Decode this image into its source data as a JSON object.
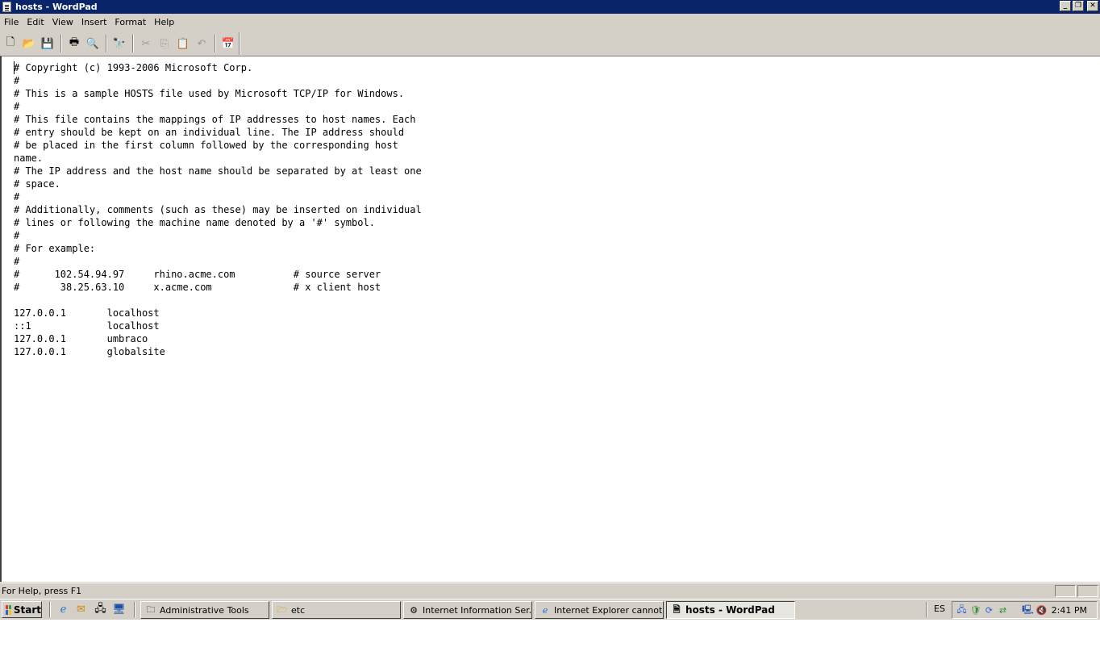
{
  "window": {
    "title": "hosts - WordPad",
    "controls": {
      "minimize": "_",
      "restore": "❐",
      "close": "✕"
    }
  },
  "menu": [
    "File",
    "Edit",
    "View",
    "Insert",
    "Format",
    "Help"
  ],
  "toolbar": {
    "icons": [
      {
        "name": "new-document-icon",
        "glyph": "🗋",
        "enabled": true
      },
      {
        "name": "open-folder-icon",
        "glyph": "📂",
        "enabled": true
      },
      {
        "name": "save-icon",
        "glyph": "💾",
        "enabled": true
      },
      {
        "name": "print-icon",
        "glyph": "🖶",
        "enabled": true
      },
      {
        "name": "print-preview-icon",
        "glyph": "🔍",
        "enabled": true
      },
      {
        "name": "find-binoculars-icon",
        "glyph": "🔭",
        "enabled": true
      },
      {
        "name": "cut-icon",
        "glyph": "✂",
        "enabled": false
      },
      {
        "name": "copy-icon",
        "glyph": "⎘",
        "enabled": false
      },
      {
        "name": "paste-icon",
        "glyph": "📋",
        "enabled": true
      },
      {
        "name": "undo-icon",
        "glyph": "↶",
        "enabled": false
      },
      {
        "name": "insert-date-time-icon",
        "glyph": "📅",
        "enabled": true
      }
    ]
  },
  "document": {
    "lines": [
      "# Copyright (c) 1993-2006 Microsoft Corp.",
      "#",
      "# This is a sample HOSTS file used by Microsoft TCP/IP for Windows.",
      "#",
      "# This file contains the mappings of IP addresses to host names. Each",
      "# entry should be kept on an individual line. The IP address should",
      "# be placed in the first column followed by the corresponding host",
      "name.",
      "# The IP address and the host name should be separated by at least one",
      "# space.",
      "#",
      "# Additionally, comments (such as these) may be inserted on individual",
      "# lines or following the machine name denoted by a '#' symbol.",
      "#",
      "# For example:",
      "#",
      "#      102.54.94.97     rhino.acme.com          # source server",
      "#       38.25.63.10     x.acme.com              # x client host",
      "",
      "127.0.0.1       localhost",
      "::1             localhost",
      "127.0.0.1       umbraco",
      "127.0.0.1       globalsite"
    ]
  },
  "status": {
    "help_text": "For Help, press F1"
  },
  "taskbar": {
    "start_label": "Start",
    "quick_launch": [
      {
        "name": "internet-explorer-icon",
        "glyph": "ℯ"
      },
      {
        "name": "outlook-icon",
        "glyph": "✉"
      },
      {
        "name": "server-manager-icon",
        "glyph": "🖧"
      },
      {
        "name": "show-desktop-icon",
        "glyph": "🖥"
      }
    ],
    "tasks": [
      {
        "label": "Administrative Tools",
        "icon": "folder-tools-icon",
        "glyph": "🗀",
        "active": false
      },
      {
        "label": "etc",
        "icon": "folder-icon",
        "glyph": "🗁",
        "active": false
      },
      {
        "label": "Internet Information Ser...",
        "icon": "iis-manager-icon",
        "glyph": "⚙",
        "active": false
      },
      {
        "label": "Internet Explorer cannot...",
        "icon": "internet-explorer-icon",
        "glyph": "ℯ",
        "active": false
      },
      {
        "label": "hosts - WordPad",
        "icon": "wordpad-icon",
        "glyph": "🗎",
        "active": true
      }
    ],
    "language": "ES",
    "tray_icons": [
      {
        "name": "network-tray-icon",
        "glyph": "🖧"
      },
      {
        "name": "security-tray-icon",
        "glyph": "🛡"
      },
      {
        "name": "update-tray-icon",
        "glyph": "⟳"
      },
      {
        "name": "sync-tray-icon",
        "glyph": "⇄"
      },
      {
        "name": "connections-tray-icon",
        "glyph": "🖳"
      },
      {
        "name": "volume-muted-tray-icon",
        "glyph": "🔇"
      }
    ],
    "clock": "2:41 PM"
  }
}
